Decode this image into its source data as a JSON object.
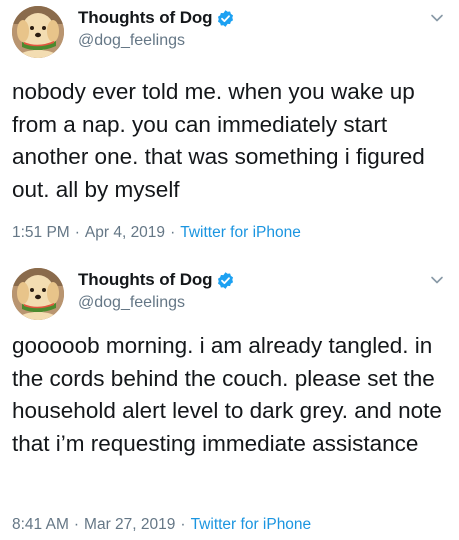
{
  "tweets": [
    {
      "display_name": "Thoughts of Dog",
      "handle": "@dog_feelings",
      "text": "nobody ever told me. when you wake up from a nap. you can immediately start another one. that was something i figured out. all by myself",
      "time": "1:51 PM",
      "date": "Apr 4, 2019",
      "source": "Twitter for iPhone",
      "separator": "·"
    },
    {
      "display_name": "Thoughts of Dog",
      "handle": "@dog_feelings",
      "text": "gooooob morning. i am already tangled. in the cords behind the couch. please set the household alert level to dark grey. and note that i’m requesting immediate assistance",
      "time": "8:41 AM",
      "date": "Mar 27, 2019",
      "source": "Twitter for iPhone",
      "separator": "·"
    }
  ],
  "icons": {
    "verified": "verified-badge-icon",
    "menu": "chevron-down-icon"
  },
  "colors": {
    "text": "#14171a",
    "secondary": "#657786",
    "link": "#1b95e0",
    "verified": "#1da1f2"
  }
}
